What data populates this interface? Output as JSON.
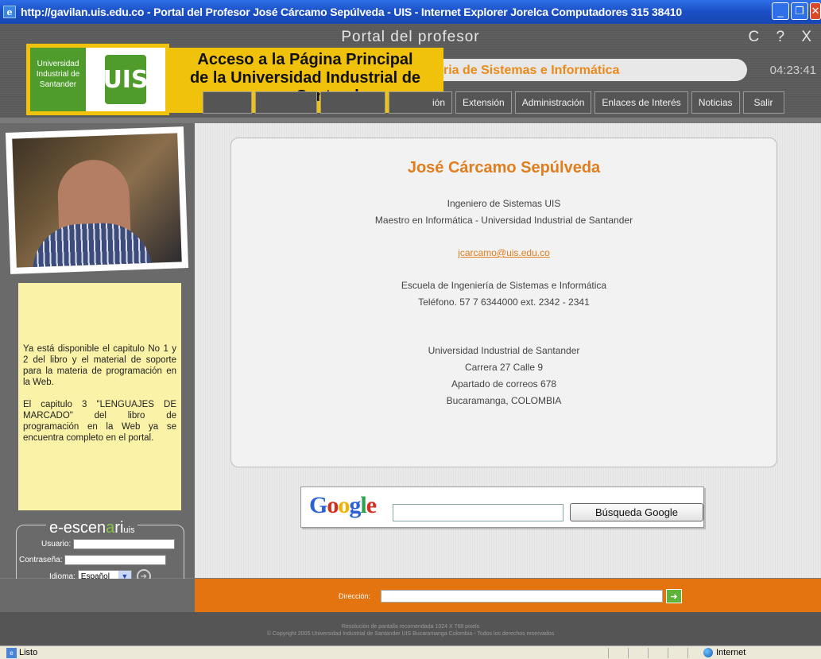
{
  "window": {
    "title": "http://gavilan.uis.edu.co - Portal del Profesor José Cárcamo Sepúlveda - UIS - Internet Explorer Jorelca Computadores 315 38410",
    "icon": "ie-page-icon"
  },
  "portal": {
    "title": "Portal del profesor",
    "header_icons": "C ? X",
    "school": "ria de Sistemas e Informática",
    "clock": "04:23:41",
    "logo_text": [
      "Universidad",
      "Industrial de",
      "Santander"
    ],
    "tooltip": [
      "Acceso a la Página Principal",
      "de la Universidad Industrial de",
      "Santander."
    ]
  },
  "nav": [
    {
      "label": ""
    },
    {
      "label": ""
    },
    {
      "label": ""
    },
    {
      "label": "ión"
    },
    {
      "label": "Extensión"
    },
    {
      "label": "Administración"
    },
    {
      "label": "Enlaces de Interés"
    },
    {
      "label": "Noticias"
    },
    {
      "label": "Salir"
    }
  ],
  "notice": {
    "p1": "Ya está disponible el capitulo No 1 y 2 del libro y el material de soporte para la materia de programación en la Web.",
    "p2": "El capitulo 3 \"LENGUAJES DE MARCADO\" del libro de programación en la Web ya se encuentra completo en el portal."
  },
  "login": {
    "brand_prefix": "e-escen",
    "brand_a": "a",
    "brand_suffix": "ri",
    "brand_sub": "uis",
    "user_label": "Usuario:",
    "password_label": "Contraseña:",
    "language_label": "Idioma:",
    "language_value": "Español"
  },
  "profile": {
    "name": "José Cárcamo Sepúlveda",
    "line1": "Ingeniero de Sistemas UIS",
    "line2": "Maestro en Informática - Universidad Industrial de Santander",
    "email": "jcarcamo@uis.edu.co",
    "school": "Escuela de Ingeniería de Sistemas e Informática",
    "phone": "Teléfono. 57 7 6344000 ext. 2342 - 2341",
    "uni": "Universidad Industrial de Santander",
    "street": "Carrera 27 Calle 9",
    "pobox": "Apartado de correos 678",
    "city": "Bucaramanga, COLOMBIA"
  },
  "google": {
    "button": "Búsqueda Google"
  },
  "address_bar": {
    "label": "Dirección:"
  },
  "footer": {
    "line1": "Resolución de pantalla recomendada 1024 X 768 pixels",
    "line2": "© Copyright 2005 Universidad Industrial de Santander UIS Bucaramanga Colombia - Todos los derechos reservados"
  },
  "statusbar": {
    "status": "Listo",
    "zone": "Internet"
  }
}
